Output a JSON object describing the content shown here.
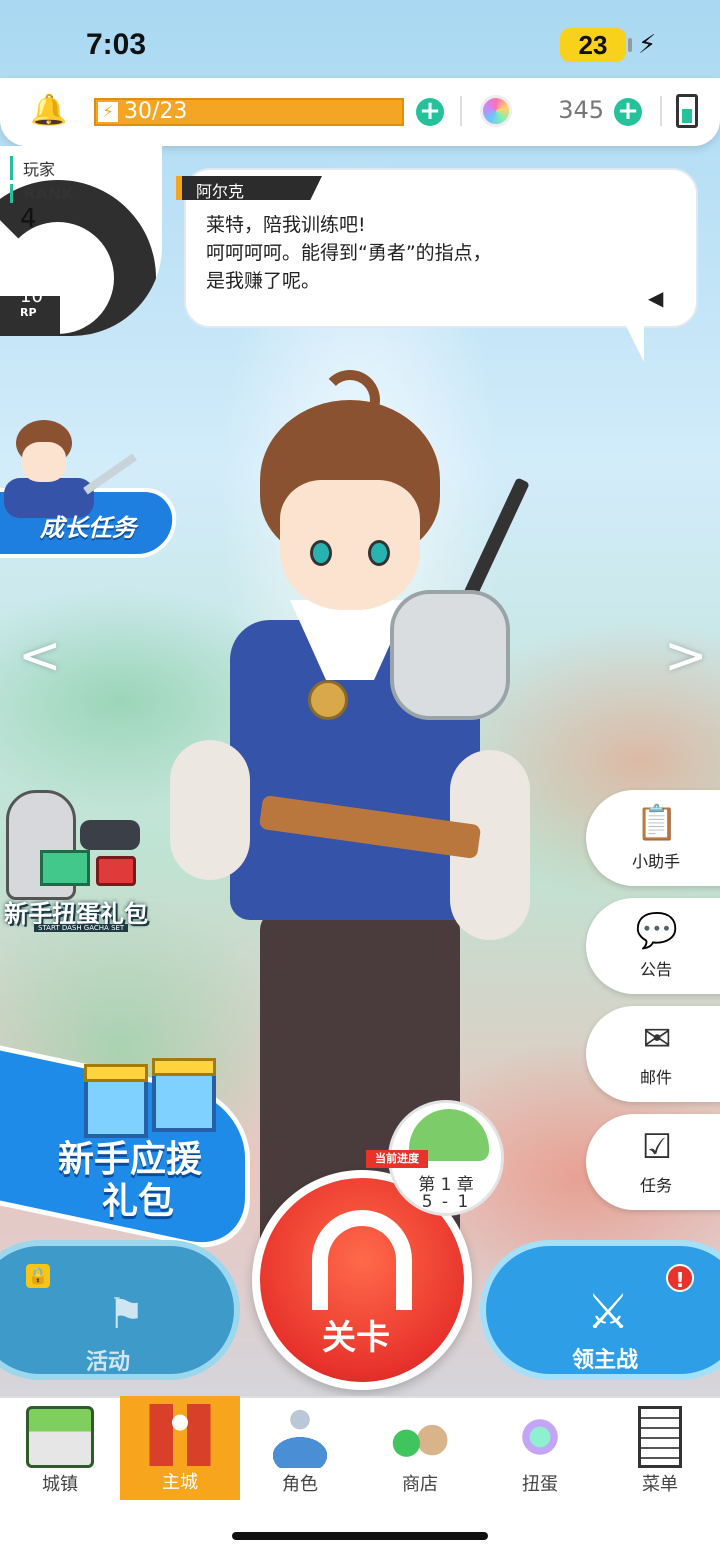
{
  "status_bar": {
    "time": "7:03",
    "battery": "23"
  },
  "resources": {
    "stamina": "30/23",
    "gems": "345"
  },
  "rank_panel": {
    "player_label": "玩家",
    "rank_label": "RANK",
    "rank_value": "4",
    "next_label": "NEXT",
    "next_value": "10",
    "next_unit": "RP"
  },
  "dialog": {
    "speaker": "阿尔克",
    "lines": [
      "莱特，陪我训练吧!",
      "呵呵呵呵。能得到“勇者”的指点，",
      "是我赚了呢。"
    ]
  },
  "left_banners": {
    "growth_tasks": "成长任务",
    "starter_gacha": "新手扭蛋礼包",
    "starter_gacha_sub": "START DASH GACHA SET",
    "starter_support_1": "新手应援",
    "starter_support_2": "礼包"
  },
  "nav": {
    "prev": "<",
    "next": ">"
  },
  "side_menu": [
    {
      "label": "小助手",
      "icon": "assistant-clipboard-icon"
    },
    {
      "label": "公告",
      "icon": "announcement-chat-icon"
    },
    {
      "label": "邮件",
      "icon": "mail-envelope-icon"
    },
    {
      "label": "任务",
      "icon": "task-checkbox-icon"
    }
  ],
  "progress": {
    "tag": "当前进度",
    "chapter": "第 1 章",
    "stage": "5 - 1"
  },
  "actions": {
    "events": "活动",
    "stage": "关卡",
    "boss": "领主战"
  },
  "tabs": [
    {
      "label": "城镇",
      "icon": "town-icon"
    },
    {
      "label": "主城",
      "icon": "main-city-icon",
      "active": true
    },
    {
      "label": "角色",
      "icon": "character-icon"
    },
    {
      "label": "商店",
      "icon": "shop-icon"
    },
    {
      "label": "扭蛋",
      "icon": "gacha-icon"
    },
    {
      "label": "菜单",
      "icon": "menu-icon"
    }
  ],
  "colors": {
    "accent_orange": "#f6a51d",
    "accent_green": "#25c19a",
    "stage_red": "#e8332c",
    "banner_blue": "#1f7fe0"
  }
}
